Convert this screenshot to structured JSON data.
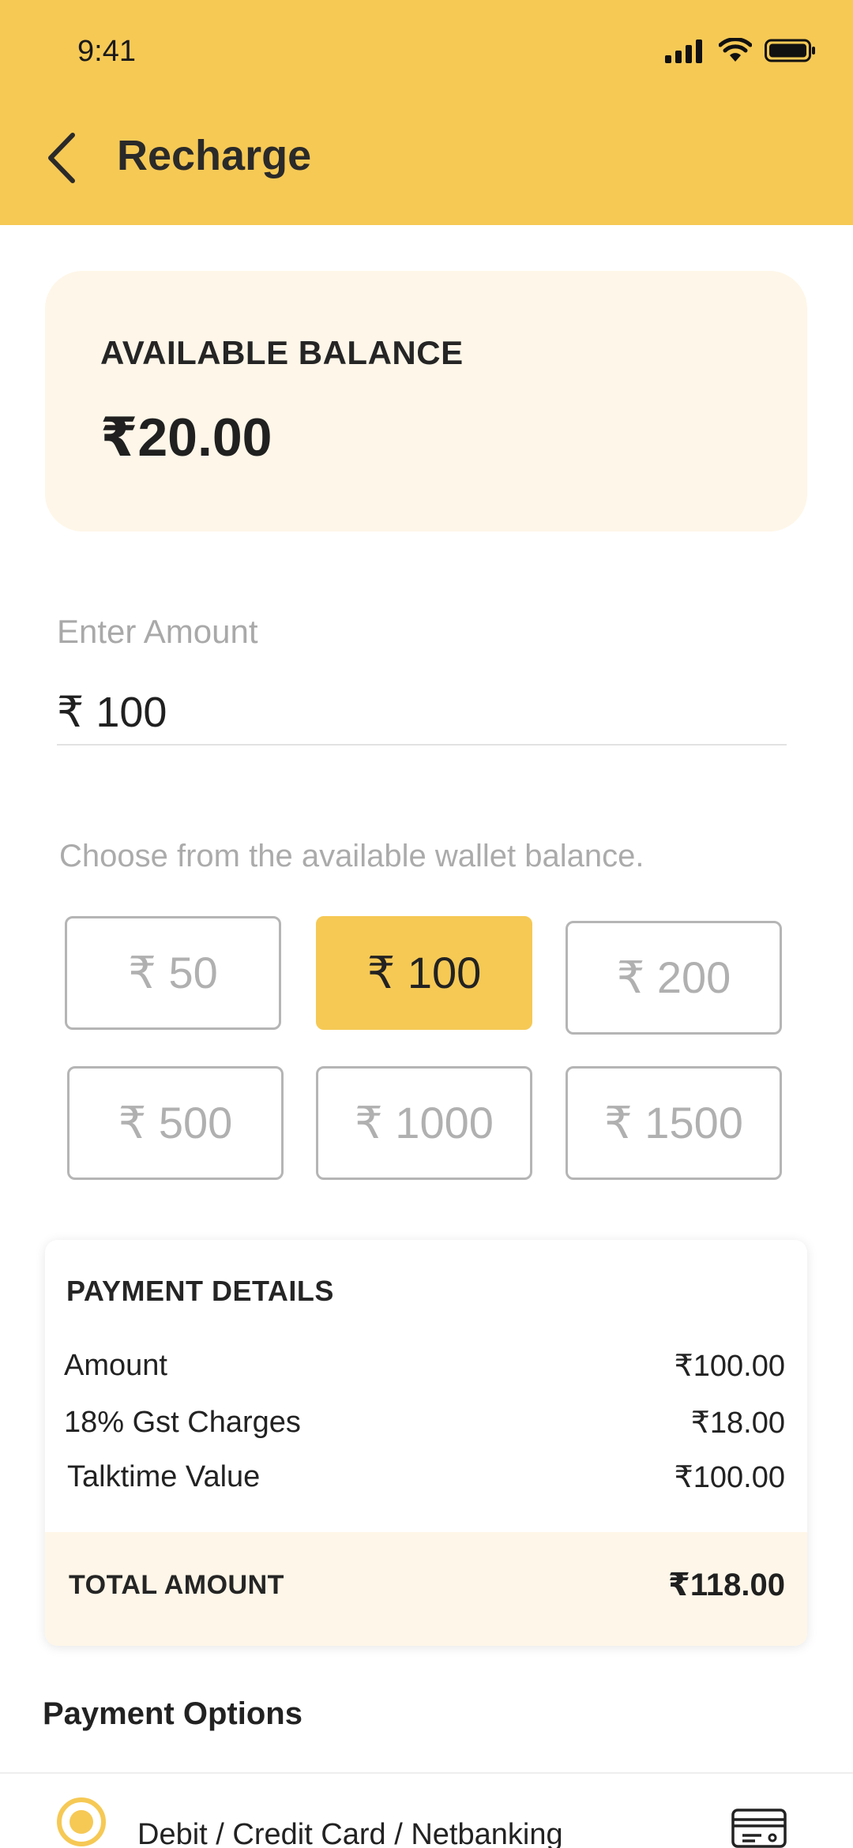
{
  "status_bar": {
    "time": "9:41",
    "icons": [
      "signal-icon",
      "wifi-icon",
      "battery-icon"
    ]
  },
  "header": {
    "title": "Recharge",
    "back_icon": "chevron-left-icon",
    "background_color": "#F6C955"
  },
  "balance": {
    "label": "AVAILABLE BALANCE",
    "value": "₹20.00"
  },
  "amount": {
    "label": "Enter Amount",
    "value": "₹ 100"
  },
  "wallet_hint": "Choose from the available wallet balance.",
  "amount_options": [
    {
      "label": "₹ 50",
      "selected": false
    },
    {
      "label": "₹ 100",
      "selected": true
    },
    {
      "label": "₹ 200",
      "selected": false
    },
    {
      "label": "₹ 500",
      "selected": false
    },
    {
      "label": "₹ 1000",
      "selected": false
    },
    {
      "label": "₹ 1500",
      "selected": false
    }
  ],
  "payment_details": {
    "title": "PAYMENT DETAILS",
    "rows": [
      {
        "label": "Amount",
        "value": "₹100.00"
      },
      {
        "label": "18% Gst Charges",
        "value": "₹18.00"
      },
      {
        "label": "Talktime Value",
        "value": "₹100.00"
      }
    ],
    "total_label": "TOTAL AMOUNT",
    "total_value": "₹118.00"
  },
  "payment_options": {
    "title": "Payment Options",
    "items": [
      {
        "label": "Debit / Credit Card / Netbanking",
        "icon": "credit-card-icon",
        "selected": true
      }
    ]
  },
  "colors": {
    "accent": "#F6C955",
    "card_background": "#FEF6E8"
  }
}
